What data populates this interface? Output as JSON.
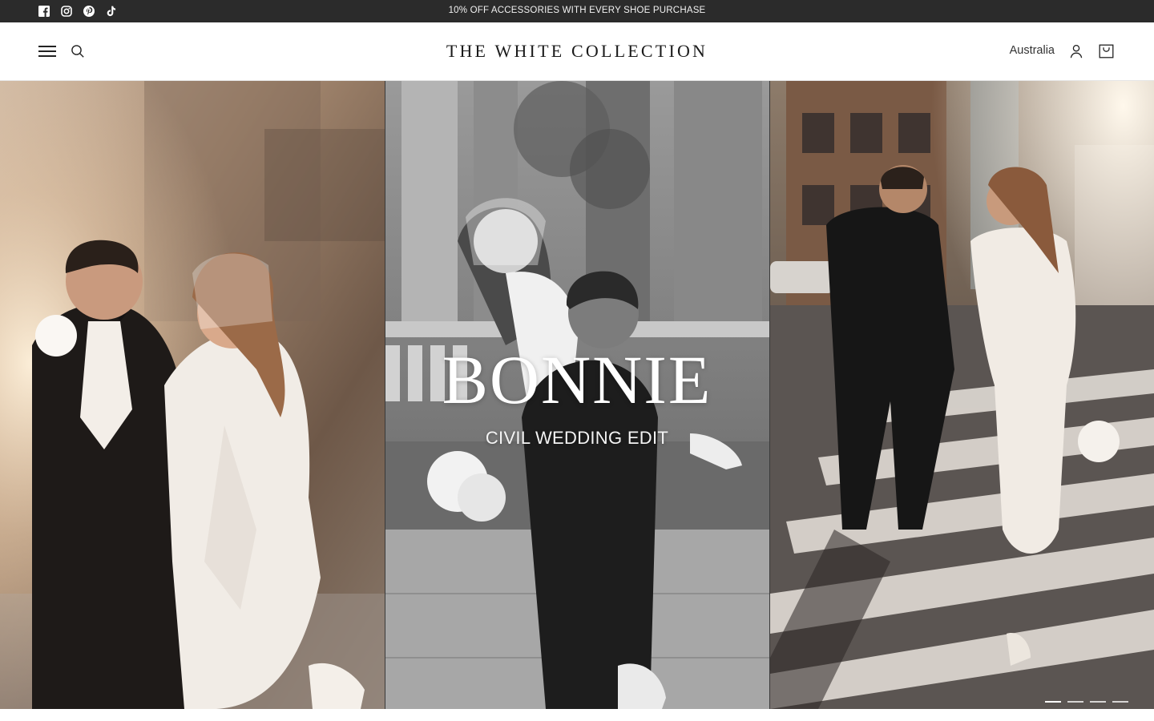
{
  "announcement": {
    "text": "10% OFF ACCESSORIES WITH EVERY SHOE PURCHASE",
    "social_icons": [
      "facebook-icon",
      "instagram-icon",
      "pinterest-icon",
      "tiktok-icon"
    ],
    "background": "#2b2b2b"
  },
  "header": {
    "logo": "THE WHITE COLLECTION",
    "country": "Australia",
    "icons": [
      "menu-icon",
      "search-icon",
      "account-icon",
      "cart-icon"
    ]
  },
  "hero": {
    "title": "BONNIE",
    "subtitle": "CIVIL WEDDING EDIT",
    "slide_count": 4,
    "active_slide": 1
  }
}
